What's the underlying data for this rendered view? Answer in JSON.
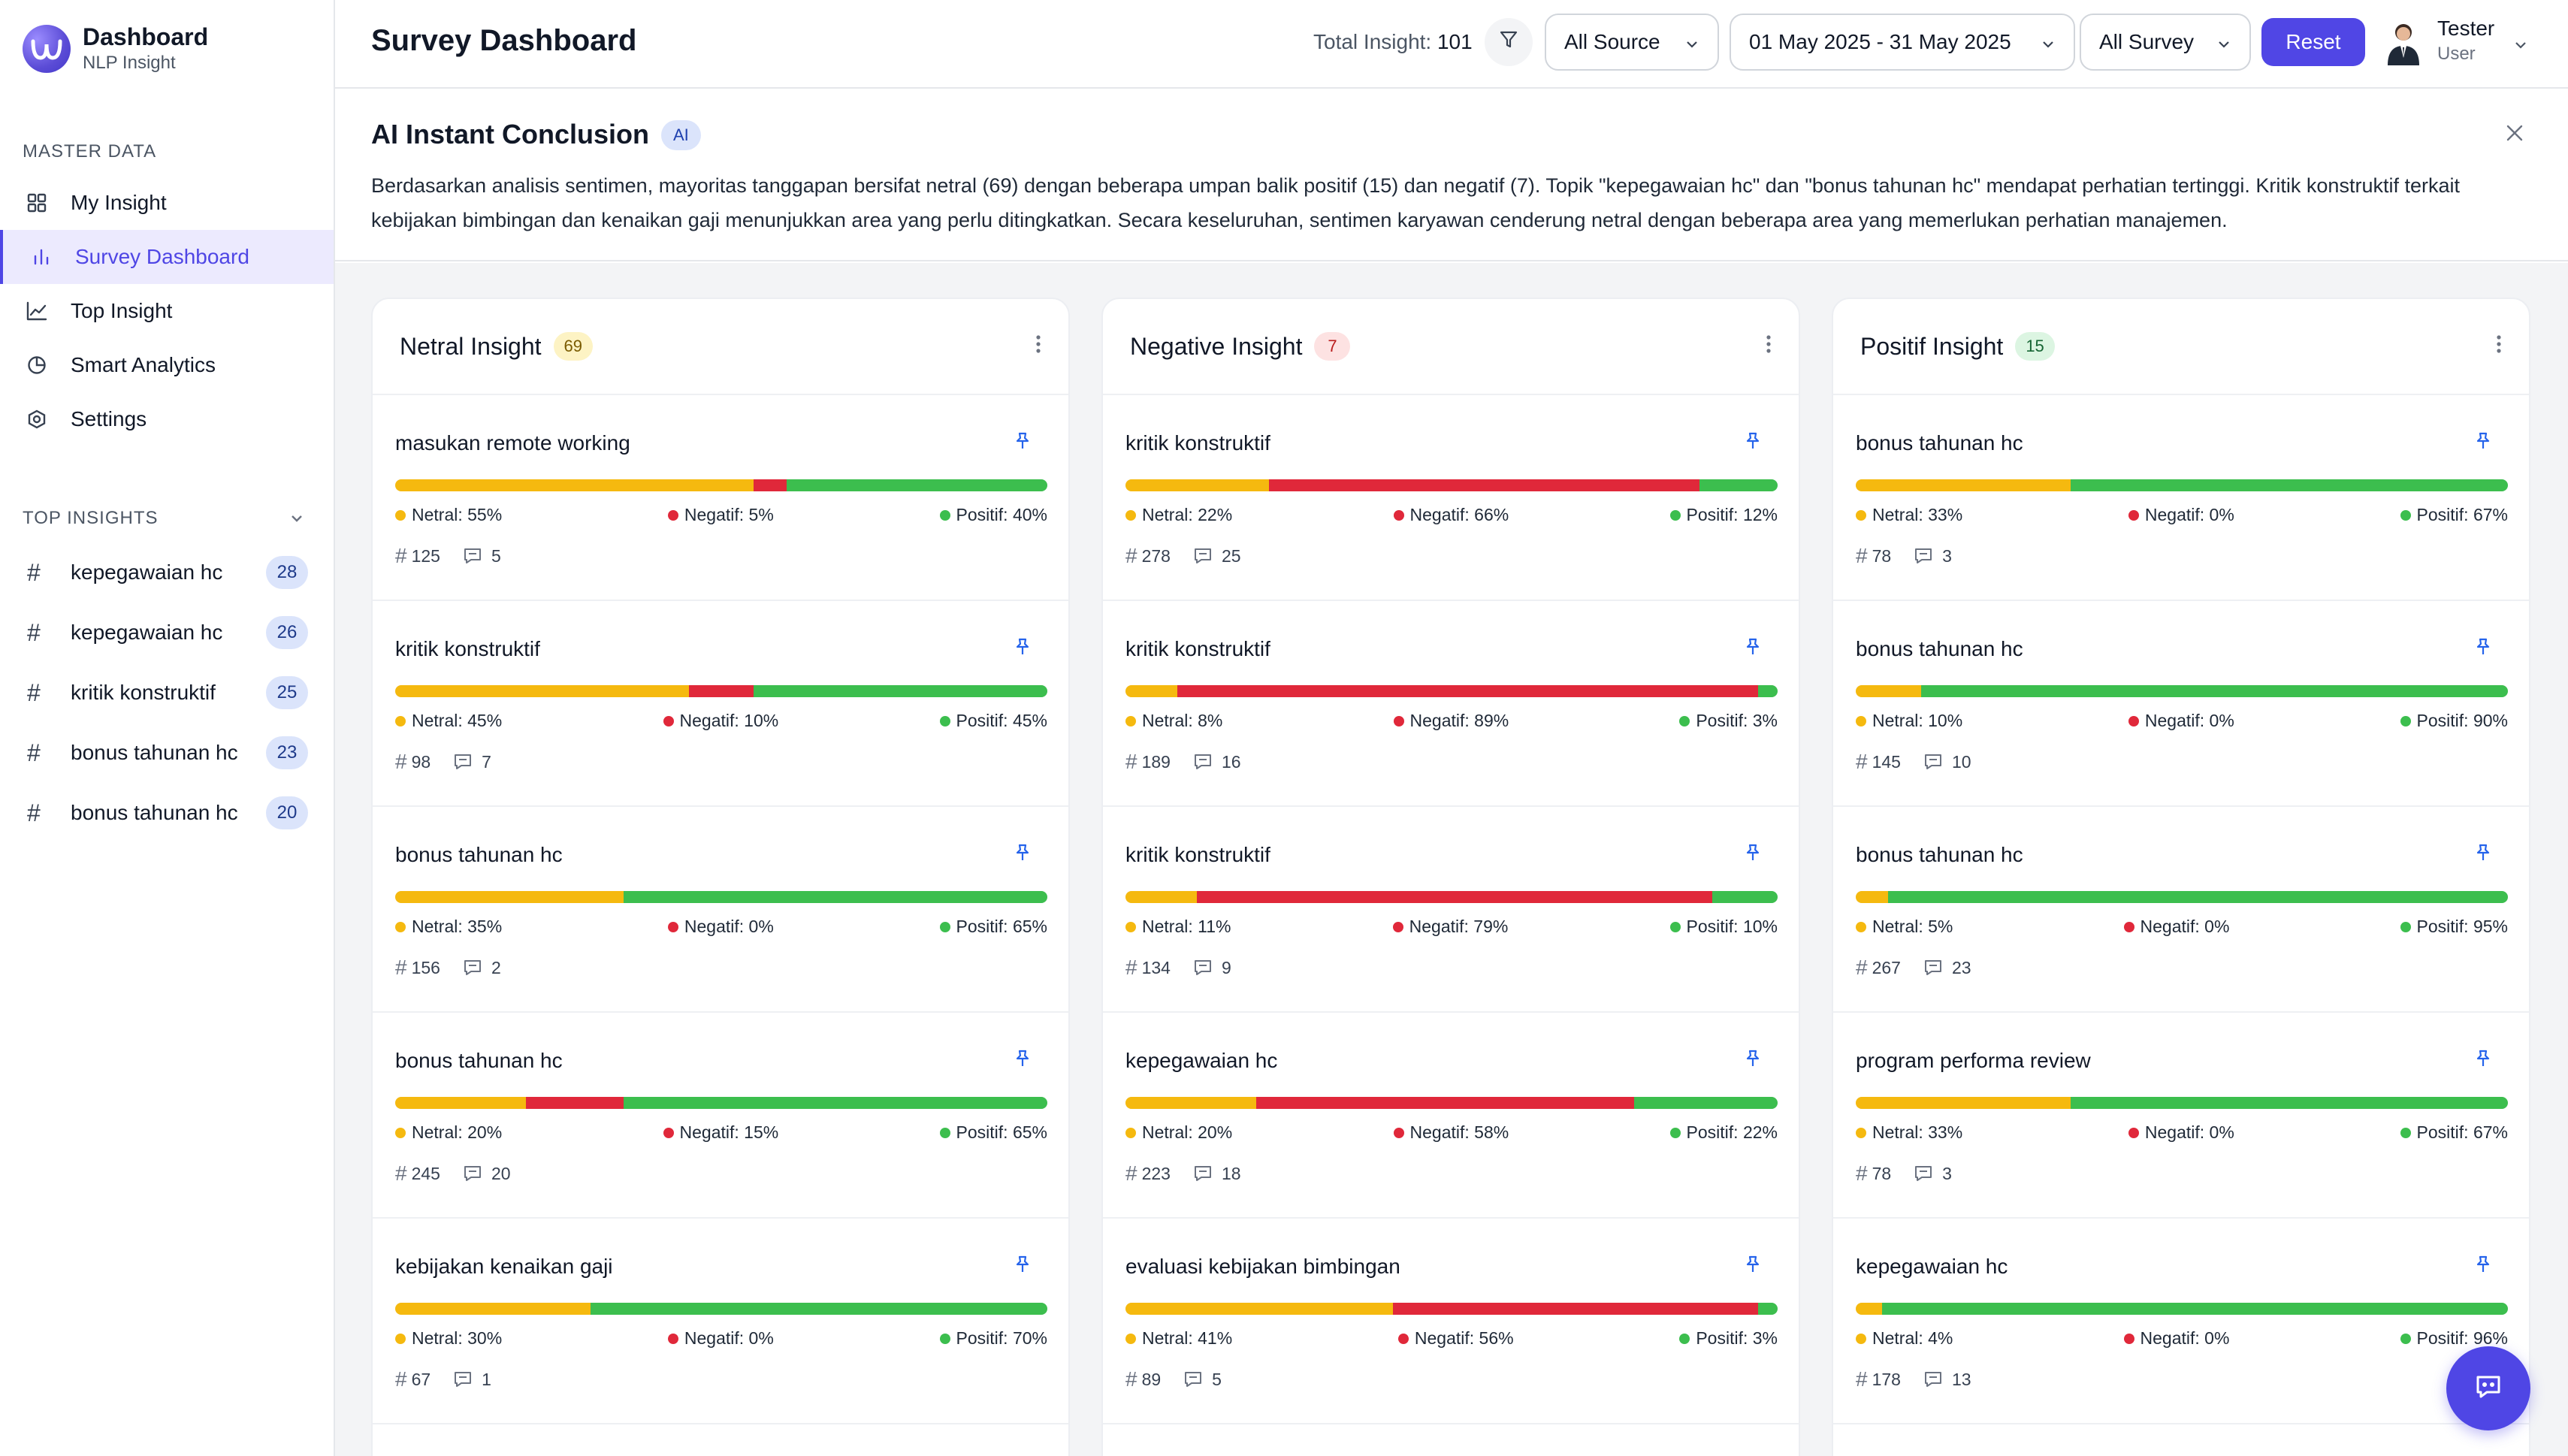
{
  "brand": {
    "title": "Dashboard",
    "subtitle": "NLP Insight"
  },
  "sidebar": {
    "master_label": "MASTER DATA",
    "nav": [
      {
        "label": "My Insight",
        "icon": "grid-icon"
      },
      {
        "label": "Survey Dashboard",
        "icon": "bar-chart-icon",
        "active": true
      },
      {
        "label": "Top Insight",
        "icon": "line-chart-icon"
      },
      {
        "label": "Smart Analytics",
        "icon": "pie-chart-icon"
      },
      {
        "label": "Settings",
        "icon": "gear-icon"
      }
    ],
    "top_label": "TOP INSIGHTS",
    "top": [
      {
        "label": "kepegawaian hc",
        "count": "28"
      },
      {
        "label": "kepegawaian hc",
        "count": "26"
      },
      {
        "label": "kritik konstruktif",
        "count": "25"
      },
      {
        "label": "bonus tahunan hc",
        "count": "23"
      },
      {
        "label": "bonus tahunan hc",
        "count": "20"
      }
    ]
  },
  "header": {
    "title": "Survey Dashboard",
    "total_label": "Total Insight:",
    "total_value": "101",
    "source": "All Source",
    "date_range": "01 May 2025 - 31 May 2025",
    "survey": "All Survey",
    "reset": "Reset",
    "user_name": "Tester",
    "user_role": "User"
  },
  "conclusion": {
    "title": "AI Instant Conclusion",
    "badge": "AI",
    "text": "Berdasarkan analisis sentimen, mayoritas tanggapan bersifat netral (69) dengan beberapa umpan balik positif (15) dan negatif (7). Topik \"kepegawaian hc\" dan \"bonus tahunan hc\" mendapat perhatian tertinggi. Kritik konstruktif terkait kebijakan bimbingan dan kenaikan gaji menunjukkan area yang perlu ditingkatkan. Secara keseluruhan, sentimen karyawan cenderung netral dengan beberapa area yang memerlukan perhatian manajemen."
  },
  "colors": {
    "netral": "#f5b90f",
    "negatif": "#e0283a",
    "positif": "#3cbe4e",
    "accent": "#5046e5"
  },
  "columns": [
    {
      "title": "Netral Insight",
      "count": "69",
      "badge_bg": "#fdf3c4",
      "badge_fg": "#7a5b00",
      "cards": [
        {
          "title": "masukan remote working",
          "netral": 55,
          "negatif": 5,
          "positif": 40,
          "n_label": "Netral: 55%",
          "g_label": "Negatif: 5%",
          "p_label": "Positif: 40%",
          "tag": "125",
          "comments": "5"
        },
        {
          "title": "kritik konstruktif",
          "netral": 45,
          "negatif": 10,
          "positif": 45,
          "n_label": "Netral: 45%",
          "g_label": "Negatif: 10%",
          "p_label": "Positif: 45%",
          "tag": "98",
          "comments": "7"
        },
        {
          "title": "bonus tahunan hc",
          "netral": 35,
          "negatif": 0,
          "positif": 65,
          "n_label": "Netral: 35%",
          "g_label": "Negatif: 0%",
          "p_label": "Positif: 65%",
          "tag": "156",
          "comments": "2"
        },
        {
          "title": "bonus tahunan hc",
          "netral": 20,
          "negatif": 15,
          "positif": 65,
          "n_label": "Netral: 20%",
          "g_label": "Negatif: 15%",
          "p_label": "Positif: 65%",
          "tag": "245",
          "comments": "20"
        },
        {
          "title": "kebijakan kenaikan gaji",
          "netral": 30,
          "negatif": 0,
          "positif": 70,
          "n_label": "Netral: 30%",
          "g_label": "Negatif: 0%",
          "p_label": "Positif: 70%",
          "tag": "67",
          "comments": "1"
        }
      ]
    },
    {
      "title": "Negative Insight",
      "count": "7",
      "badge_bg": "#fde2e2",
      "badge_fg": "#b91c1c",
      "cards": [
        {
          "title": "kritik konstruktif",
          "netral": 22,
          "negatif": 66,
          "positif": 12,
          "n_label": "Netral: 22%",
          "g_label": "Negatif: 66%",
          "p_label": "Positif: 12%",
          "tag": "278",
          "comments": "25"
        },
        {
          "title": "kritik konstruktif",
          "netral": 8,
          "negatif": 89,
          "positif": 3,
          "n_label": "Netral: 8%",
          "g_label": "Negatif: 89%",
          "p_label": "Positif: 3%",
          "tag": "189",
          "comments": "16"
        },
        {
          "title": "kritik konstruktif",
          "netral": 11,
          "negatif": 79,
          "positif": 10,
          "n_label": "Netral: 11%",
          "g_label": "Negatif: 79%",
          "p_label": "Positif: 10%",
          "tag": "134",
          "comments": "9"
        },
        {
          "title": "kepegawaian hc",
          "netral": 20,
          "negatif": 58,
          "positif": 22,
          "n_label": "Netral: 20%",
          "g_label": "Negatif: 58%",
          "p_label": "Positif: 22%",
          "tag": "223",
          "comments": "18"
        },
        {
          "title": "evaluasi kebijakan bimbingan",
          "netral": 41,
          "negatif": 56,
          "positif": 3,
          "n_label": "Netral: 41%",
          "g_label": "Negatif: 56%",
          "p_label": "Positif: 3%",
          "tag": "89",
          "comments": "5"
        }
      ]
    },
    {
      "title": "Positif Insight",
      "count": "15",
      "badge_bg": "#dcf5e2",
      "badge_fg": "#166534",
      "cards": [
        {
          "title": "bonus tahunan hc",
          "netral": 33,
          "negatif": 0,
          "positif": 67,
          "n_label": "Netral: 33%",
          "g_label": "Negatif: 0%",
          "p_label": "Positif: 67%",
          "tag": "78",
          "comments": "3"
        },
        {
          "title": "bonus tahunan hc",
          "netral": 10,
          "negatif": 0,
          "positif": 90,
          "n_label": "Netral: 10%",
          "g_label": "Negatif: 0%",
          "p_label": "Positif: 90%",
          "tag": "145",
          "comments": "10"
        },
        {
          "title": "bonus tahunan hc",
          "netral": 5,
          "negatif": 0,
          "positif": 95,
          "n_label": "Netral: 5%",
          "g_label": "Negatif: 0%",
          "p_label": "Positif: 95%",
          "tag": "267",
          "comments": "23"
        },
        {
          "title": "program performa review",
          "netral": 33,
          "negatif": 0,
          "positif": 67,
          "n_label": "Netral: 33%",
          "g_label": "Negatif: 0%",
          "p_label": "Positif: 67%",
          "tag": "78",
          "comments": "3"
        },
        {
          "title": "kepegawaian hc",
          "netral": 4,
          "negatif": 0,
          "positif": 96,
          "n_label": "Netral: 4%",
          "g_label": "Negatif: 0%",
          "p_label": "Positif: 96%",
          "tag": "178",
          "comments": "13"
        }
      ]
    }
  ]
}
